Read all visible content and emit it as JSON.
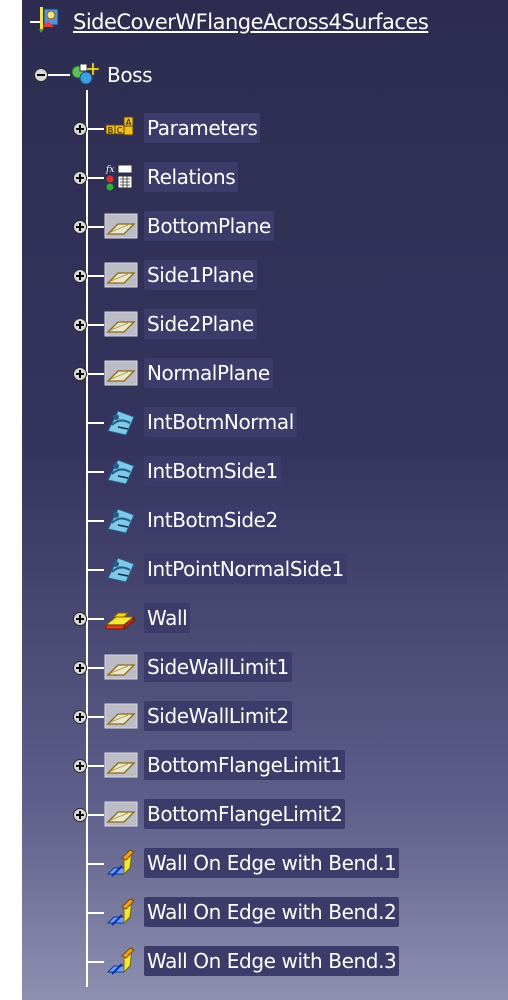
{
  "colors": {
    "background_top": "#2d2c50",
    "background_bottom": "#8e90b1",
    "label_bg": "#3c3c6a",
    "text": "#ffffff"
  },
  "tree": {
    "root": {
      "label": "SideCoverWFlangeAcross4Surfaces",
      "icon": "part-icon"
    },
    "body": {
      "label": "Boss",
      "icon": "body-icon",
      "expanded": true
    },
    "items": [
      {
        "label": "Parameters",
        "icon": "parameters-icon",
        "expandable": true
      },
      {
        "label": "Relations",
        "icon": "relations-icon",
        "expandable": true
      },
      {
        "label": "BottomPlane",
        "icon": "plane-icon",
        "expandable": true
      },
      {
        "label": "Side1Plane",
        "icon": "plane-icon",
        "expandable": true
      },
      {
        "label": "Side2Plane",
        "icon": "plane-icon",
        "expandable": true
      },
      {
        "label": "NormalPlane",
        "icon": "plane-icon",
        "expandable": true
      },
      {
        "label": "IntBotmNormal",
        "icon": "intersection-icon",
        "expandable": false
      },
      {
        "label": "IntBotmSide1",
        "icon": "intersection-icon",
        "expandable": false
      },
      {
        "label": "IntBotmSide2",
        "icon": "intersection-icon",
        "expandable": false
      },
      {
        "label": "IntPointNormalSide1",
        "icon": "intersection-icon",
        "expandable": false
      },
      {
        "label": "Wall",
        "icon": "wall-icon",
        "expandable": true
      },
      {
        "label": "SideWallLimit1",
        "icon": "plane-icon",
        "expandable": true
      },
      {
        "label": "SideWallLimit2",
        "icon": "plane-icon",
        "expandable": true
      },
      {
        "label": "BottomFlangeLimit1",
        "icon": "plane-icon",
        "expandable": true
      },
      {
        "label": "BottomFlangeLimit2",
        "icon": "plane-icon",
        "expandable": true
      },
      {
        "label": "Wall On Edge with Bend.1",
        "icon": "wall-on-edge-icon",
        "expandable": false
      },
      {
        "label": "Wall On Edge with Bend.2",
        "icon": "wall-on-edge-icon",
        "expandable": false
      },
      {
        "label": "Wall On Edge with Bend.3",
        "icon": "wall-on-edge-icon",
        "expandable": false
      }
    ]
  }
}
